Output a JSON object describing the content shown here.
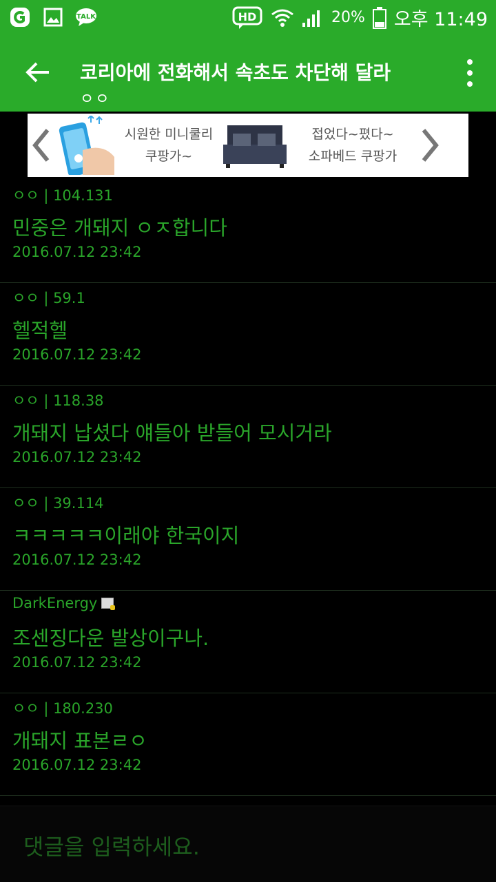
{
  "statusbar": {
    "icons": [
      "kakao-chat-icon",
      "gallery-icon",
      "talk-icon"
    ],
    "hd_label": "HD",
    "battery": "20%",
    "time": "오후 11:49"
  },
  "appbar": {
    "title": "코리아에 전화해서 속초도 차단해 달라",
    "subtitle": "ㅇㅇ",
    "accent": "#2aab2a"
  },
  "ad": {
    "item1": [
      "시원한 미니쿨리",
      "쿠팡가~"
    ],
    "item2": [
      "접었다~폈다~",
      "소파베드 쿠팡가"
    ]
  },
  "comments": [
    {
      "author": "ㅇㅇ | 104.131",
      "body": "민중은 개돼지 ㅇㅈ합니다",
      "date": "2016.07.12 23:42"
    },
    {
      "author": "ㅇㅇ | 59.1",
      "body": "헬적헬",
      "date": "2016.07.12 23:42"
    },
    {
      "author": "ㅇㅇ | 118.38",
      "body": "개돼지 납셨다 얘들아 받들어 모시거라",
      "date": "2016.07.12 23:42"
    },
    {
      "author": "ㅇㅇ | 39.114",
      "body": "ㅋㅋㅋㅋㅋ이래야 한국이지",
      "date": "2016.07.12 23:42"
    },
    {
      "author": "DarkEnergy",
      "body": "조센징다운 발상이구나.",
      "date": "2016.07.12 23:42",
      "member": true
    },
    {
      "author": "ㅇㅇ | 180.230",
      "body": "개돼지 표본ㄹㅇ",
      "date": "2016.07.12 23:42"
    }
  ],
  "input": {
    "placeholder": "댓글을 입력하세요."
  }
}
